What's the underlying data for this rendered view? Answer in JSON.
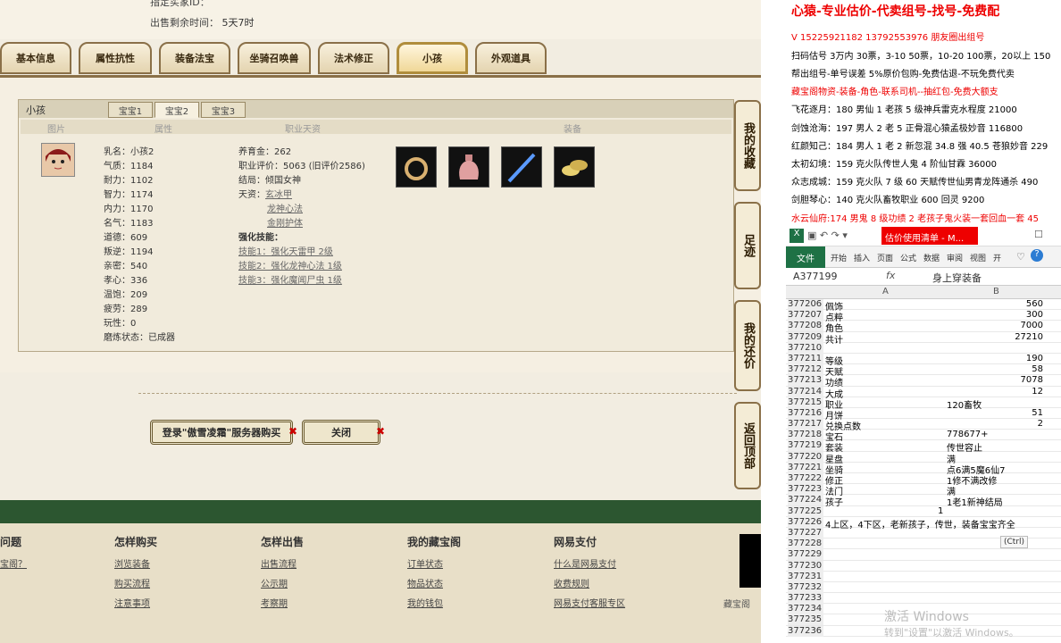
{
  "top": {
    "sale_time_label": "出售剩余时间：",
    "sale_time_value": "5天7时",
    "cut_label": "指定买家ID："
  },
  "tabs": [
    "基本信息",
    "属性抗性",
    "装备法宝",
    "坐骑召唤兽",
    "法术修正",
    "小孩",
    "外观道具"
  ],
  "detail": {
    "title": "小孩",
    "baby_tabs": [
      "宝宝1",
      "宝宝2",
      "宝宝3"
    ],
    "columns": [
      "图片",
      "属性",
      "职业天资",
      "装备"
    ],
    "attrs": [
      "乳名：小孩2",
      "气质：1184",
      "耐力：1102",
      "智力：1174",
      "内力：1170",
      "名气：1183",
      "道德：609",
      "叛逆：1194",
      "亲密：540",
      "孝心：336",
      "温饱：209",
      "疲劳：289",
      "玩性：0",
      "磨炼状态：已成器"
    ],
    "info": {
      "nurture": "养育金：262",
      "career_eval": "职业评价：5063 (旧评价2586)",
      "ending": "结局：倾国女神",
      "talent_label": "天资：",
      "talents": [
        "玄冰甲",
        "龙神心法",
        "金刚护体"
      ],
      "skills_label": "强化技能：",
      "skills": [
        "技能1：强化天雷甲 2级",
        "技能2：强化龙神心法 1级",
        "技能3：强化魔闻尸虫 1级"
      ]
    }
  },
  "side_buttons": [
    "我的收藏",
    "足迹",
    "我的还价",
    "返回顶部"
  ],
  "buttons": {
    "login_buy": "登录\"傲雪凌霜\"服务器购买",
    "close": "关闭"
  },
  "footer": {
    "cols": [
      {
        "head": "问题",
        "links": [
          "宝阁？",
          "",
          ""
        ]
      },
      {
        "head": "怎样购买",
        "links": [
          "浏览装备",
          "购买流程",
          "注意事项"
        ]
      },
      {
        "head": "怎样出售",
        "links": [
          "出售流程",
          "公示期",
          "考察期"
        ]
      },
      {
        "head": "我的藏宝阁",
        "links": [
          "订单状态",
          "物品状态",
          "我的钱包"
        ]
      },
      {
        "head": "网易支付",
        "links": [
          "什么是网易支付",
          "收费规则",
          "网易支付客服专区"
        ]
      }
    ],
    "corner": "藏宝阁"
  },
  "right": {
    "heading": "心猿-专业估价-代卖组号-找号-免费配",
    "lines": [
      {
        "t": "V 15225921182   13792553976 朋友圈出组号",
        "red": true
      },
      {
        "t": "扫码估号 3万内 30票，3-10 50票，10-20 100票，20以上 150",
        "red": false
      },
      {
        "t": "帮出组号-单号误差 5%原价包购-免费估退-不玩免费代卖",
        "red": false
      },
      {
        "t": "藏宝阁物资-装备-角色-联系司机--抽红包-免费大额支",
        "red": true
      },
      {
        "t": "飞花逐月：180 男仙 1 老孩 5 级神兵雷克水程度 21000",
        "red": false
      },
      {
        "t": "剑蚀沧海：197 男人 2 老 5 正骨混心猿孟极妙音 116800",
        "red": false
      },
      {
        "t": "红颜知己：184 男人 1 老 2 新忽混 34.8 强 40.5 苍狼妙音 229",
        "red": false
      },
      {
        "t": "太初幻境：159 克火队传世人鬼 4 阶仙甘霖 36000",
        "red": false
      },
      {
        "t": "众志成城：159 克火队 7 级 60 天赋传世仙男青龙阵通杀 490",
        "red": false
      },
      {
        "t": "剑胆琴心：140 克火队畜牧职业 600 回灵 9200",
        "red": false
      },
      {
        "t": "水云仙府:174 男鬼 8 级功绩 2 老孩子鬼火装一套回血一套 45",
        "red": true
      }
    ],
    "excel": {
      "title": "估价使用清单 - M...",
      "tabs": [
        "文件",
        "开始",
        "插入",
        "页面",
        "公式",
        "数据",
        "审阅",
        "视图",
        "开"
      ],
      "namebox": "A377199",
      "formula": "身上穿装备",
      "col_a": "A",
      "col_b": "B",
      "rows": [
        {
          "n": "377206",
          "a": "佩饰",
          "b": "560"
        },
        {
          "n": "377207",
          "a": "点粹",
          "b": "300"
        },
        {
          "n": "377208",
          "a": "角色",
          "b": "7000"
        },
        {
          "n": "377209",
          "a": "共计",
          "b": "27210"
        },
        {
          "n": "377210",
          "a": "",
          "b": ""
        },
        {
          "n": "377211",
          "a": "等级",
          "b": "190"
        },
        {
          "n": "377212",
          "a": "天赋",
          "b": "58"
        },
        {
          "n": "377213",
          "a": "功绩",
          "b": "7078"
        },
        {
          "n": "377214",
          "a": "大成",
          "b": "12"
        },
        {
          "n": "377215",
          "a": "职业",
          "b": "120畜牧",
          "t": true
        },
        {
          "n": "377216",
          "a": "月饼",
          "b": "51"
        },
        {
          "n": "377217",
          "a": "兑换点数",
          "b": "2"
        },
        {
          "n": "377218",
          "a": "宝石",
          "b": "778677+",
          "t": true
        },
        {
          "n": "377219",
          "a": "套装",
          "b": "传世容止",
          "t": true
        },
        {
          "n": "377220",
          "a": "星盘",
          "b": "满",
          "t": true
        },
        {
          "n": "377221",
          "a": "坐骑",
          "b": "点6满5魔6仙7",
          "t": true
        },
        {
          "n": "377222",
          "a": "修正",
          "b": "1修不满改修",
          "t": true
        },
        {
          "n": "377223",
          "a": "法门",
          "b": "满",
          "t": true
        },
        {
          "n": "377224",
          "a": "孩子",
          "b": "1老1新神结局",
          "t": true
        },
        {
          "n": "377225",
          "a": "",
          "b": "1",
          "mid": true
        },
        {
          "n": "377226",
          "a": "4上区，4下区，老新孩子，传世，装备宝宝齐全",
          "b": ""
        },
        {
          "n": "377227",
          "a": "",
          "b": ""
        },
        {
          "n": "377228",
          "a": "",
          "b": ""
        },
        {
          "n": "377229",
          "a": "",
          "b": ""
        },
        {
          "n": "377230",
          "a": "",
          "b": ""
        },
        {
          "n": "377231",
          "a": "",
          "b": ""
        },
        {
          "n": "377232",
          "a": "",
          "b": ""
        },
        {
          "n": "377233",
          "a": "",
          "b": ""
        },
        {
          "n": "377234",
          "a": "",
          "b": ""
        },
        {
          "n": "377235",
          "a": "",
          "b": ""
        },
        {
          "n": "377236",
          "a": "",
          "b": ""
        }
      ],
      "paste_tag": "(Ctrl)"
    },
    "watermark_1": "激活 Windows",
    "watermark_2": "转到\"设置\"以激活 Windows。"
  }
}
